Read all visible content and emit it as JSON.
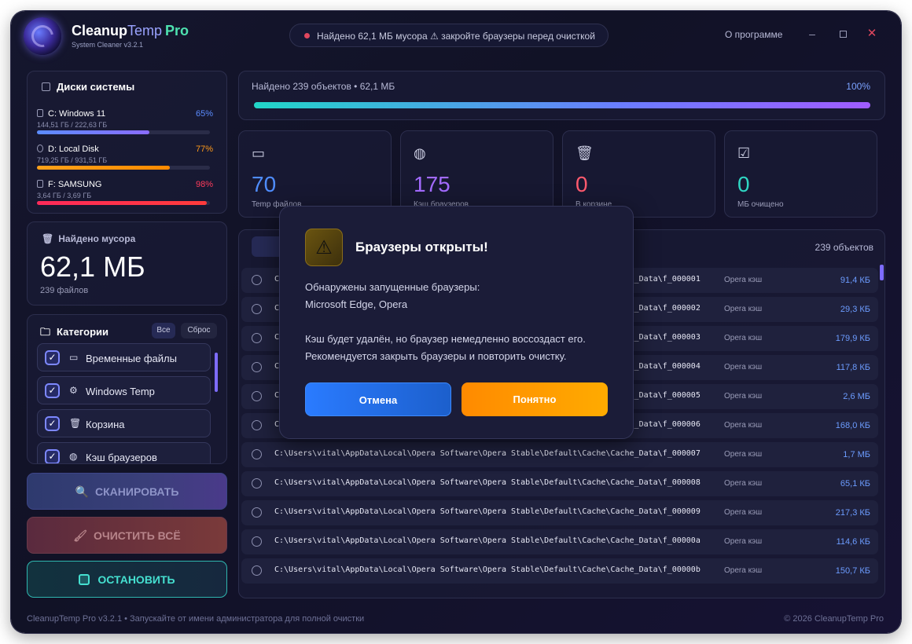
{
  "app": {
    "name_part1": "Cleanup",
    "name_part2": "Temp",
    "name_part3": "Pro",
    "subtitle": "System Cleaner v3.2.1",
    "status": "Найдено 62,1 МБ мусора ⚠ закройте браузеры перед очисткой",
    "about": "О программе"
  },
  "disks": {
    "title": "Диски системы",
    "items": [
      {
        "name": "C:  Windows 11",
        "pct": "65%",
        "size": "144,51 ГБ / 222,63 ГБ",
        "fill": 0.65,
        "color": "#5b8cff"
      },
      {
        "name": "D:  Local Disk",
        "pct": "77%",
        "size": "719,25 ГБ / 931,51 ГБ",
        "fill": 0.77,
        "color": "#ff9a1a"
      },
      {
        "name": "F:  SAMSUNG",
        "pct": "98%",
        "size": "3,64 ГБ / 3,69 ГБ",
        "fill": 0.98,
        "color": "#ff3b5c"
      }
    ]
  },
  "junk": {
    "label": "Найдено мусора",
    "value": "62,1 МБ",
    "files": "239 файлов"
  },
  "categories": {
    "title": "Категории",
    "all_btn": "Все",
    "reset_btn": "Сброс",
    "items": [
      {
        "label": "Временные файлы",
        "icon": "calendar-icon"
      },
      {
        "label": "Windows Temp",
        "icon": "gear-icon"
      },
      {
        "label": "Корзина",
        "icon": "trash-icon"
      },
      {
        "label": "Кэш браузеров",
        "icon": "globe-icon"
      }
    ]
  },
  "buttons": {
    "scan": "СКАНИРОВАТЬ",
    "clean": "ОЧИСТИТЬ ВСЁ",
    "stop": "ОСТАНОВИТЬ"
  },
  "progress": {
    "label": "Найдено 239 объектов • 62,1 МБ",
    "pct": "100%",
    "fill": 1.0
  },
  "stats": [
    {
      "value": "70",
      "label": "Temp файлов",
      "color": "#4f8dff",
      "icon": "calendar-icon"
    },
    {
      "value": "175",
      "label": "Кэш браузеров",
      "color": "#a36bff",
      "icon": "globe-icon"
    },
    {
      "value": "0",
      "label": "В корзине",
      "color": "#ff5a6e",
      "icon": "trash-icon"
    },
    {
      "value": "0",
      "label": "МБ очищено",
      "color": "#2fd6c3",
      "icon": "checkbox-icon"
    }
  ],
  "files": {
    "count": "239 объектов",
    "rows": [
      {
        "path": "C:\\Users\\vital\\AppData\\Local\\Opera Software\\Opera Stable\\Default\\Cache\\Cache_Data\\f_000001",
        "type": "Opera кэш",
        "size": "91,4 КБ"
      },
      {
        "path": "C:\\Users\\vital\\AppData\\Local\\Opera Software\\Opera Stable\\Default\\Cache\\Cache_Data\\f_000002",
        "type": "Opera кэш",
        "size": "29,3 КБ"
      },
      {
        "path": "C:\\Users\\vital\\AppData\\Local\\Opera Software\\Opera Stable\\Default\\Cache\\Cache_Data\\f_000003",
        "type": "Opera кэш",
        "size": "179,9 КБ"
      },
      {
        "path": "C:\\Users\\vital\\AppData\\Local\\Opera Software\\Opera Stable\\Default\\Cache\\Cache_Data\\f_000004",
        "type": "Opera кэш",
        "size": "117,8 КБ"
      },
      {
        "path": "C:\\Users\\vital\\AppData\\Local\\Opera Software\\Opera Stable\\Default\\Cache\\Cache_Data\\f_000005",
        "type": "Opera кэш",
        "size": "2,6 МБ"
      },
      {
        "path": "C:\\Users\\vital\\AppData\\Local\\Opera Software\\Opera Stable\\Default\\Cache\\Cache_Data\\f_000006",
        "type": "Opera кэш",
        "size": "168,0 КБ"
      },
      {
        "path": "C:\\Users\\vital\\AppData\\Local\\Opera Software\\Opera Stable\\Default\\Cache\\Cache_Data\\f_000007",
        "type": "Opera кэш",
        "size": "1,7 МБ"
      },
      {
        "path": "C:\\Users\\vital\\AppData\\Local\\Opera Software\\Opera Stable\\Default\\Cache\\Cache_Data\\f_000008",
        "type": "Opera кэш",
        "size": "65,1 КБ"
      },
      {
        "path": "C:\\Users\\vital\\AppData\\Local\\Opera Software\\Opera Stable\\Default\\Cache\\Cache_Data\\f_000009",
        "type": "Opera кэш",
        "size": "217,3 КБ"
      },
      {
        "path": "C:\\Users\\vital\\AppData\\Local\\Opera Software\\Opera Stable\\Default\\Cache\\Cache_Data\\f_00000a",
        "type": "Opera кэш",
        "size": "114,6 КБ"
      },
      {
        "path": "C:\\Users\\vital\\AppData\\Local\\Opera Software\\Opera Stable\\Default\\Cache\\Cache_Data\\f_00000b",
        "type": "Opera кэш",
        "size": "150,7 КБ"
      }
    ]
  },
  "footer": {
    "left": "CleanupTemp Pro v3.2.1  •  Запускайте от имени администратора для полной очистки",
    "right": "© 2026 CleanupTemp Pro"
  },
  "dialog": {
    "title": "Браузеры открыты!",
    "line1": "Обнаружены запущенные браузеры:",
    "line2": "Microsoft Edge, Opera",
    "line3": "Кэш будет удалён, но браузер немедленно воссоздаст его.",
    "line4": "Рекомендуется закрыть браузеры и повторить очистку.",
    "cancel": "Отмена",
    "ok": "Понятно"
  }
}
